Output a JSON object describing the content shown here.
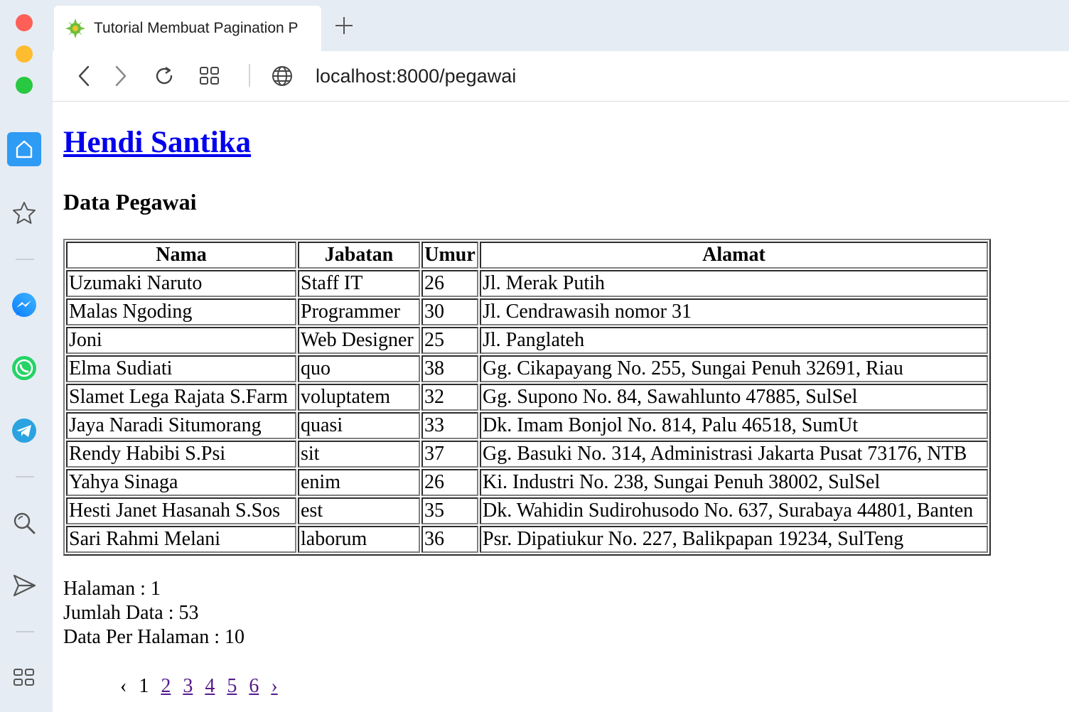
{
  "browser": {
    "tab_title": "Tutorial Membuat Pagination P",
    "url": "localhost:8000/pegawai"
  },
  "page": {
    "site_title": "Hendi Santika",
    "section_title": "Data Pegawai",
    "table": {
      "headers": [
        "Nama",
        "Jabatan",
        "Umur",
        "Alamat"
      ],
      "rows": [
        [
          "Uzumaki Naruto",
          "Staff IT",
          "26",
          "Jl. Merak Putih"
        ],
        [
          "Malas Ngoding",
          "Programmer",
          "30",
          "Jl. Cendrawasih nomor 31"
        ],
        [
          "Joni",
          "Web Designer",
          "25",
          "Jl. Panglateh"
        ],
        [
          "Elma Sudiati",
          "quo",
          "38",
          "Gg. Cikapayang No. 255, Sungai Penuh 32691, Riau"
        ],
        [
          "Slamet Lega Rajata S.Farm",
          "voluptatem",
          "32",
          "Gg. Supono No. 84, Sawahlunto 47885, SulSel"
        ],
        [
          "Jaya Naradi Situmorang",
          "quasi",
          "33",
          "Dk. Imam Bonjol No. 814, Palu 46518, SumUt"
        ],
        [
          "Rendy Habibi S.Psi",
          "sit",
          "37",
          "Gg. Basuki No. 314, Administrasi Jakarta Pusat 73176, NTB"
        ],
        [
          "Yahya Sinaga",
          "enim",
          "26",
          "Ki. Industri No. 238, Sungai Penuh 38002, SulSel"
        ],
        [
          "Hesti Janet Hasanah S.Sos",
          "est",
          "35",
          "Dk. Wahidin Sudirohusodo No. 637, Surabaya 44801, Banten"
        ],
        [
          "Sari Rahmi Melani",
          "laborum",
          "36",
          "Psr. Dipatiukur No. 227, Balikpapan 19234, SulTeng"
        ]
      ]
    },
    "info": {
      "halaman": "Halaman : 1",
      "jumlah": "Jumlah Data : 53",
      "per_halaman": "Data Per Halaman : 10"
    },
    "pagination": {
      "prev": "‹",
      "current": "1",
      "pages": [
        "2",
        "3",
        "4",
        "5",
        "6"
      ],
      "next": "›"
    }
  },
  "colors": {
    "link": "#0000ee",
    "visited": "#551a8b",
    "sidebar_bg": "#e6ecf3",
    "accent": "#2e9bf5"
  },
  "icons": {
    "sidebar": [
      "home-icon",
      "star-icon",
      "messenger-icon",
      "whatsapp-icon",
      "telegram-icon",
      "search-icon",
      "send-icon",
      "apps-icon"
    ],
    "toolbar": [
      "back-icon",
      "forward-icon",
      "reload-icon",
      "tabs-grid-icon",
      "globe-icon"
    ]
  }
}
